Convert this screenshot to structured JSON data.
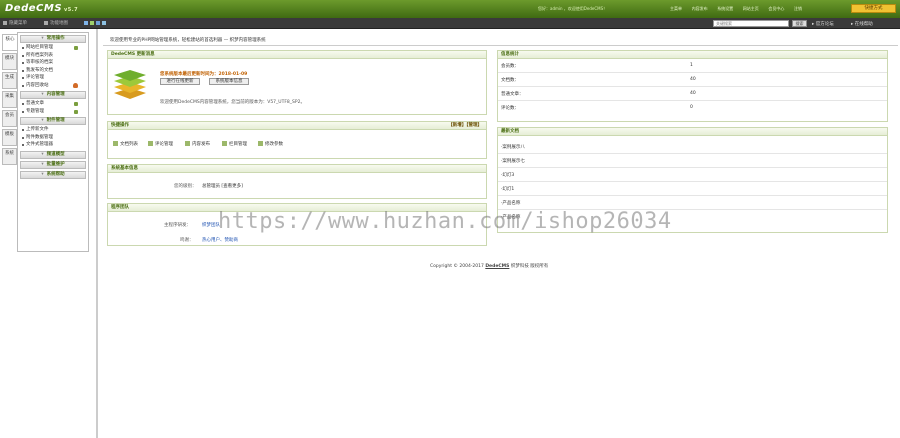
{
  "header": {
    "logo": "DedeCMS",
    "version": "v5.7",
    "user_info": "您好：admin ，欢迎使用DedeCMS！",
    "nav": [
      "主菜单",
      "内容发布",
      "系统设置",
      "网站主页",
      "会员中心",
      "注销"
    ],
    "quick_button": "快捷方式"
  },
  "toolbar": {
    "hide_menu": "隐藏菜单",
    "func_map": "功能地图",
    "search_placeholder": "关键搜索",
    "search_button": "搜索",
    "official_forum": "官方论坛",
    "online_help": "在线帮助"
  },
  "tabs": [
    "核心",
    "模块",
    "生成",
    "采集",
    "会员",
    "模板",
    "系统"
  ],
  "sidebar": {
    "sections": [
      {
        "title": "常用操作",
        "items": [
          "网站栏目管理",
          "所有档案列表",
          "等审核的档案",
          "我发布的文档",
          "评论管理",
          "内容回收站"
        ]
      },
      {
        "title": "内容管理",
        "items": [
          "普通文章",
          "专题管理"
        ]
      },
      {
        "title": "附件管理",
        "items": [
          "上传新文件",
          "附件数据管理",
          "文件式管理器"
        ]
      },
      {
        "title": "频道模型"
      },
      {
        "title": "批量维护"
      },
      {
        "title": "系统帮助"
      }
    ]
  },
  "main": {
    "welcome": "欢迎使用专业的PHP网站管理系统，轻松建站的首选利器 — 织梦内容管理系统",
    "update_panel": {
      "title": "DedeCMS 更新消息",
      "headline": "您系统版本最后更新时间为：2018-01-09",
      "buttons": [
        "进行在线更新",
        "系统版本信息"
      ],
      "message": "欢迎使用DedeCMS内容管理系统，您当前的版本为：V57_UTF8_SP2。"
    },
    "quick_panel": {
      "title": "快捷操作",
      "links": "【新增】【管理】",
      "items": [
        "文档列表",
        "评论管理",
        "内容发布",
        "栏目管理",
        "修改参数"
      ]
    },
    "sysinfo_panel": {
      "title": "系统基本信息",
      "label": "您的级别：",
      "value": "总管理员 [查看更多]"
    },
    "team_panel": {
      "title": "程序团队",
      "dev_label": "主程序研发：",
      "dev_value": "织梦团队",
      "thanks_label": "鸣谢：",
      "thanks_value": "热心用户、赞助商"
    },
    "stats_panel": {
      "title": "信息统计",
      "rows": [
        {
          "label": "会员数：",
          "value": "1"
        },
        {
          "label": "文档数：",
          "value": "40"
        },
        {
          "label": "普通文章：",
          "value": "40"
        },
        {
          "label": "评论数：",
          "value": "0"
        }
      ]
    },
    "latest_panel": {
      "title": "最新文档",
      "items": [
        "·案例展示八",
        "·案例展示七",
        "·幻灯3",
        "·幻灯1",
        "·产品名称",
        "·产品名称"
      ]
    },
    "copyright_prefix": "Copyright © 2004-2017 ",
    "copyright_brand": "DedeCMS",
    "copyright_suffix": " 织梦科技 版权所有",
    "watermark": "https://www.huzhan.com/ishop26034"
  }
}
